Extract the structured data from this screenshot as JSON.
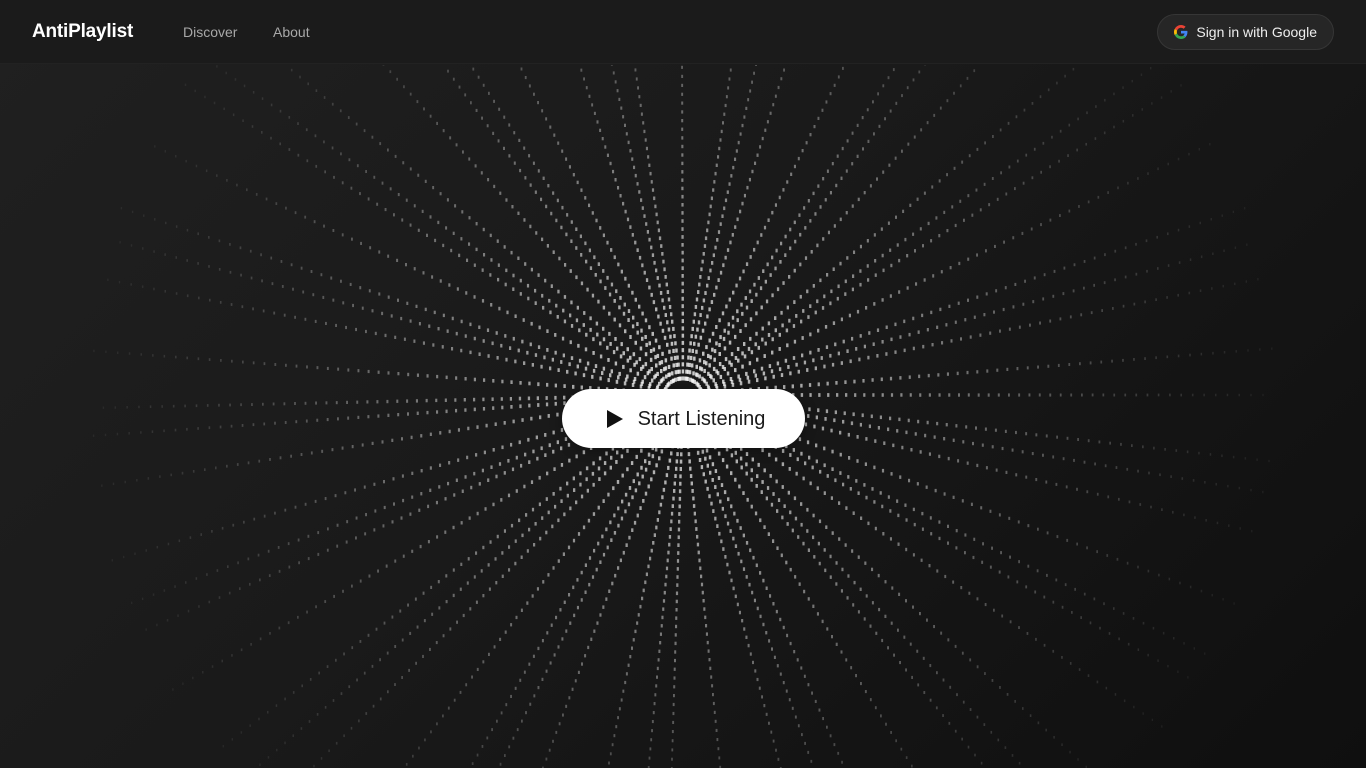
{
  "nav": {
    "brand": "AntiPlaylist",
    "links": [
      "Discover",
      "About"
    ],
    "signin_label": "Sign in with Google",
    "signin_icon": "google-g-icon"
  },
  "hero": {
    "cta_label": "Start Listening",
    "cta_icon": "play-icon",
    "background_visual": "radial-dot-burst"
  },
  "colors": {
    "background": "#141414",
    "navbar": "#1b1b1b",
    "brand_text": "#ffffff",
    "nav_link": "#a8a8a8",
    "cta_background": "#ffffff",
    "cta_text": "#1a1a1a",
    "dots": "#ffffff",
    "google_red": "#ea4335",
    "google_yellow": "#fbbc05",
    "google_green": "#34a853",
    "google_blue": "#4285f4"
  }
}
